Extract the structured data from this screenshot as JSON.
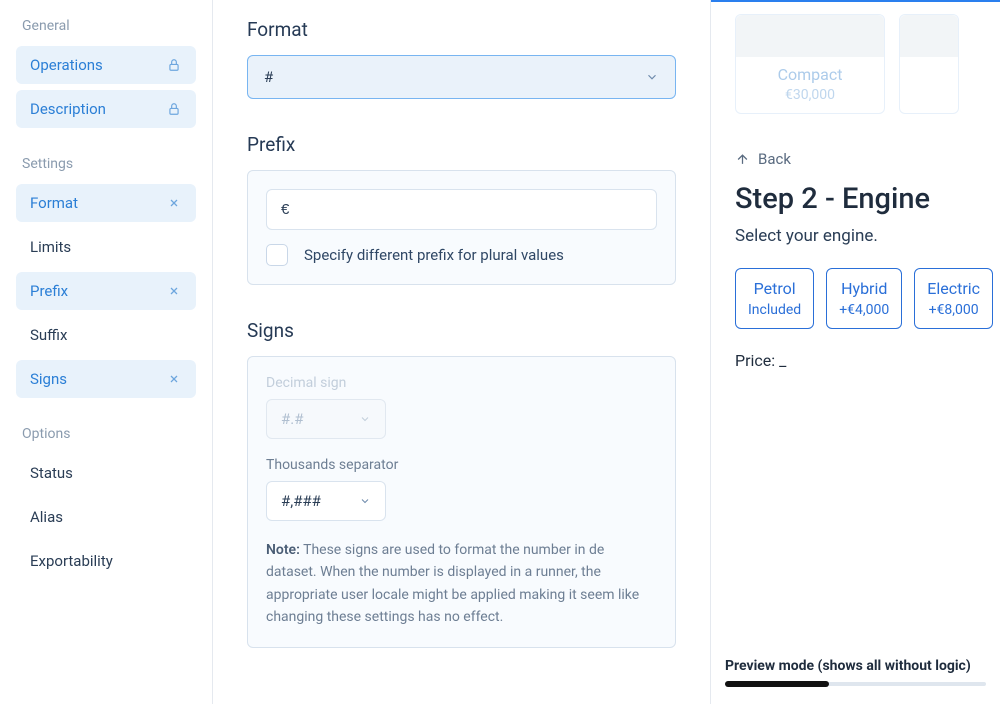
{
  "sidebar": {
    "groups": [
      {
        "label": "General",
        "items": [
          {
            "label": "Operations",
            "active": true,
            "icon": "lock"
          },
          {
            "label": "Description",
            "active": true,
            "icon": "lock"
          }
        ]
      },
      {
        "label": "Settings",
        "items": [
          {
            "label": "Format",
            "active": true,
            "icon": "close"
          },
          {
            "label": "Limits",
            "active": false
          },
          {
            "label": "Prefix",
            "active": true,
            "icon": "close"
          },
          {
            "label": "Suffix",
            "active": false
          },
          {
            "label": "Signs",
            "active": true,
            "icon": "close"
          }
        ]
      },
      {
        "label": "Options",
        "items": [
          {
            "label": "Status",
            "active": false
          },
          {
            "label": "Alias",
            "active": false
          },
          {
            "label": "Exportability",
            "active": false
          }
        ]
      }
    ]
  },
  "format": {
    "heading": "Format",
    "value": "#"
  },
  "prefix": {
    "heading": "Prefix",
    "value": "€",
    "plural_checkbox_label": "Specify different prefix for plural values"
  },
  "signs": {
    "heading": "Signs",
    "decimal_label": "Decimal sign",
    "decimal_value": "#.#",
    "thousands_label": "Thousands separator",
    "thousands_value": "#,###",
    "note_prefix": "Note:",
    "note_body": " These signs are used to format the number in de dataset. When the number is displayed in a runner, the appropriate user locale might be applied making it seem like changing these settings has no effect."
  },
  "preview": {
    "car": {
      "name": "Compact",
      "price": "€30,000"
    },
    "back_label": "Back",
    "step_title": "Step 2 - Engine",
    "step_subtitle": "Select your engine.",
    "engines": [
      {
        "name": "Petrol",
        "price": "Included"
      },
      {
        "name": "Hybrid",
        "price": "+€4,000"
      },
      {
        "name": "Electric",
        "price": "+€8,000"
      }
    ],
    "price_label": "Price: _",
    "footer_label": "Preview mode (shows all without logic)"
  }
}
